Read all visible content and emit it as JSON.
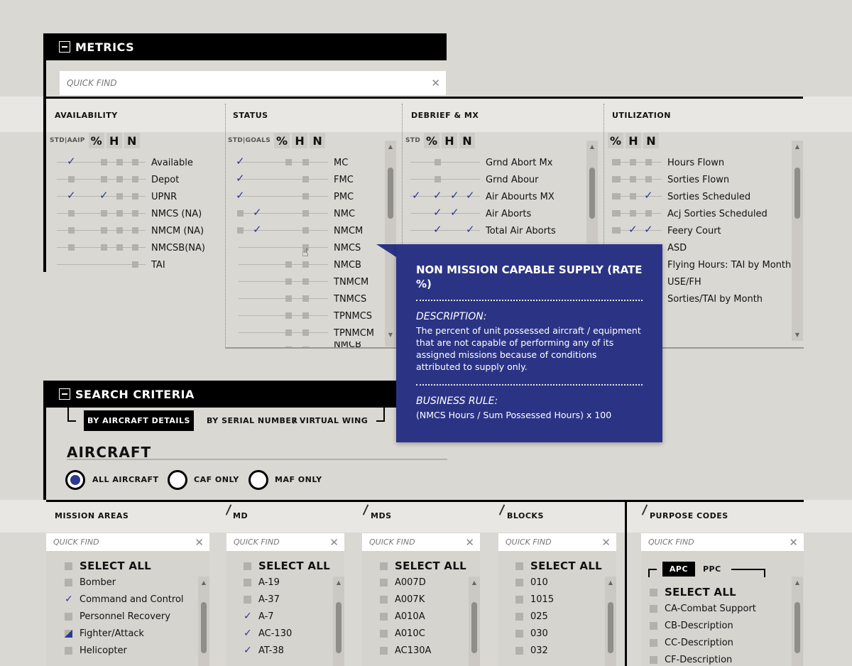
{
  "metrics": {
    "title": "METRICS",
    "quick_find": "QUICK FIND",
    "availability": {
      "header": "AVAILABILITY",
      "level_label": "STD|AAIP",
      "levels": [
        "%",
        "H",
        "N"
      ],
      "items": [
        "Available",
        "Depot",
        "UPNR",
        "NMCS (NA)",
        "NMCM (NA)",
        "NMCSB(NA)",
        "TAI"
      ]
    },
    "status": {
      "header": "STATUS",
      "level_label": "STD|GOALS",
      "levels": [
        "%",
        "H",
        "N"
      ],
      "items": [
        "MC",
        "FMC",
        "PMC",
        "NMC",
        "NMCM",
        "NMCS",
        "NMCB",
        "TNMCM",
        "TNMCS",
        "TPNMCS",
        "TPNMCM",
        "NMCB"
      ]
    },
    "debrief": {
      "header": "DEBRIEF & MX",
      "level_label": "STD",
      "levels": [
        "%",
        "H",
        "N"
      ],
      "items": [
        "Grnd Abort Mx",
        "Grnd Abour",
        "Air Abourts MX",
        "Air Aborts",
        "Total Air Aborts"
      ]
    },
    "utilization": {
      "header": "UTILIZATION",
      "levels": [
        "%",
        "H",
        "N"
      ],
      "items": [
        "Hours Flown",
        "Sorties Flown",
        "Sorties Scheduled",
        "Acj Sorties Scheduled",
        "Feery Court",
        "ASD",
        "Flying Hours: TAI by Month",
        "USE/FH",
        "Sorties/TAI by Month"
      ]
    }
  },
  "tooltip": {
    "title": "NON MISSION CAPABLE SUPPLY (RATE %)",
    "description_label": "DESCRIPTION:",
    "description": "The percent of unit possessed aircraft / equipment that are not capable of performing any of its assigned missions because of conditions attributed to supply only.",
    "rule_label": "BUSINESS RULE:",
    "rule": "(NMCS Hours / Sum Possessed Hours) x 100"
  },
  "search": {
    "title": "SEARCH CRITERIA",
    "tabs": [
      "BY AIRCRAFT DETAILS",
      "BY SERIAL NUMBER",
      "/ VIRTUAL WING"
    ],
    "section_title": "AIRCRAFT",
    "radios": [
      "ALL AIRCRAFT",
      "CAF ONLY",
      "MAF ONLY"
    ],
    "quick_find": "QUICK FIND",
    "select_all": "SELECT ALL",
    "mission_areas": {
      "header": "MISSION AREAS",
      "items": [
        "Bomber",
        "Command and Control",
        "Personnel Recovery",
        "Fighter/Attack",
        "Helicopter"
      ]
    },
    "md": {
      "header": "MD",
      "items": [
        "A-19",
        "A-37",
        "A-7",
        "AC-130",
        "AT-38"
      ]
    },
    "mds": {
      "header": "MDS",
      "items": [
        "A007D",
        "A007K",
        "A010A",
        "A010C",
        "AC130A"
      ]
    },
    "blocks": {
      "header": "BLOCKS",
      "items": [
        "010",
        "1015",
        "025",
        "030",
        "032"
      ]
    },
    "purpose": {
      "header": "PURPOSE CODES",
      "tabs": [
        "APC",
        "PPC"
      ],
      "items": [
        "CA-Combat Support",
        "CB-Description",
        "CC-Description",
        "CF-Description"
      ]
    }
  },
  "colors": {
    "accent": "#2b3990",
    "tooltip_bg": "#2b3484",
    "check": "#2a3a8c"
  }
}
